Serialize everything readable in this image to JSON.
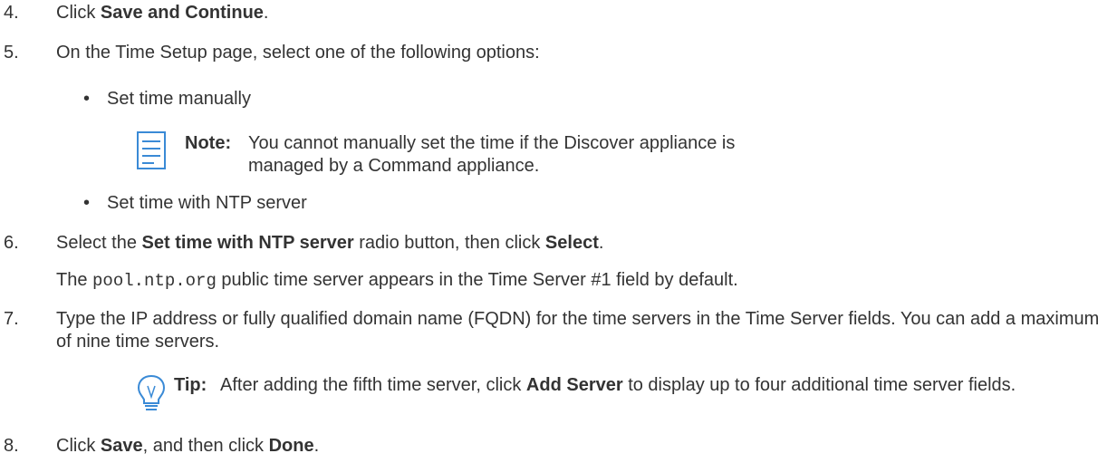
{
  "steps": [
    {
      "number": "4.",
      "before": "Click ",
      "bold": "Save and Continue",
      "after": "."
    },
    {
      "number": "5.",
      "text": "On the Time Setup page, select one of the following options:"
    },
    {
      "number": "6.",
      "before": "Select the ",
      "bold1": "Set time with NTP server",
      "middle": " radio button, then click ",
      "bold2": "Select",
      "after": "."
    },
    {
      "number": "7.",
      "text": "Type the IP address or fully qualified domain name (FQDN) for the time servers in the Time Server fields. You can add a maximum of nine time servers."
    },
    {
      "number": "8.",
      "before": "Click ",
      "bold1": "Save",
      "middle": ", and then click ",
      "bold2": "Done",
      "after": "."
    }
  ],
  "options": {
    "bullet_char": "•",
    "manual": "Set time manually",
    "ntp": "Set time with NTP server"
  },
  "note": {
    "label": "Note:",
    "text": "You cannot manually set the time if the Discover appliance is managed by a Command appliance."
  },
  "step6_detail": {
    "before": "The ",
    "code": "pool.ntp.org",
    "after": " public time server appears in the Time Server #1 field by default."
  },
  "tip": {
    "label": "Tip:",
    "before": "After adding the fifth time server, click ",
    "bold": "Add Server",
    "after": " to display up to four additional time server fields."
  },
  "colors": {
    "text": "#333333",
    "icon_blue": "#3a8ad6"
  }
}
